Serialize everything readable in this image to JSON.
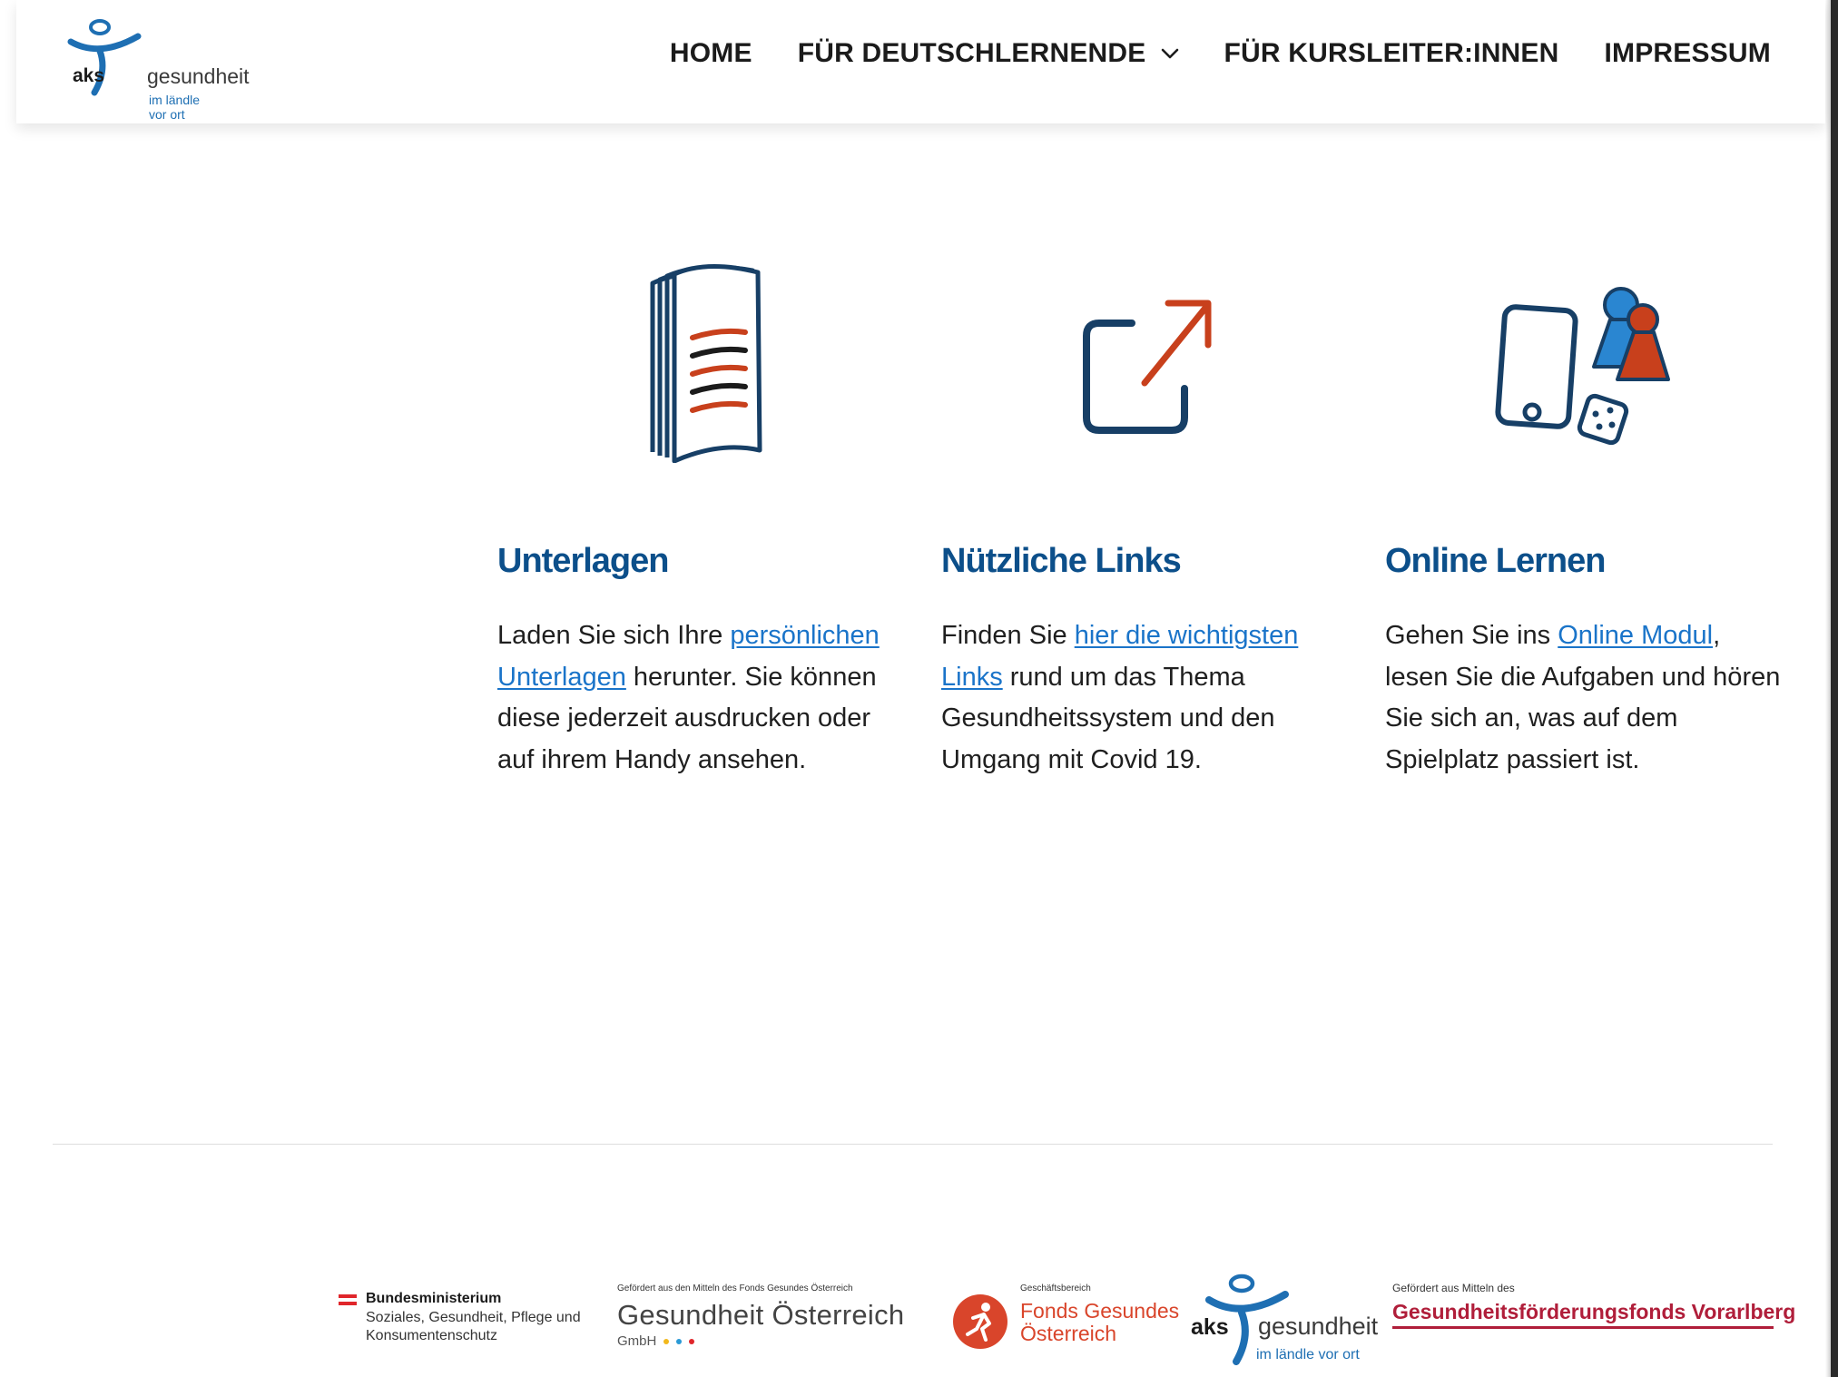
{
  "header": {
    "logo": {
      "brand": "aks",
      "name": "gesundheit",
      "tagline": "im ländle vor ort"
    },
    "nav": [
      {
        "label": "HOME"
      },
      {
        "label": "FÜR DEUTSCHLERNENDE",
        "has_dropdown": true
      },
      {
        "label": "FÜR KURSLEITER:INNEN"
      },
      {
        "label": "IMPRESSUM"
      }
    ]
  },
  "features": [
    {
      "icon": "documents-icon",
      "title": "Unterlagen",
      "text_before": "Laden Sie sich Ihre ",
      "link": "persönlichen Unterlagen",
      "text_after": " herunter. Sie können diese jederzeit ausdrucken oder auf ihrem Handy ansehen."
    },
    {
      "icon": "external-link-icon",
      "title": "Nützliche Links",
      "text_before": "Finden Sie ",
      "link": "hier die wichtigsten Links",
      "text_after": " rund um das Thema Gesundheitssystem und den Umgang mit Covid 19."
    },
    {
      "icon": "phone-game-icon",
      "title": "Online Lernen",
      "text_before": "Gehen Sie ins ",
      "link": "Online Modul",
      "text_after": ", lesen Sie die Aufgaben und hören Sie sich an, was auf dem Spielplatz passiert ist."
    }
  ],
  "footer": {
    "bmsgpk": {
      "title": "Bundesministerium",
      "sub": "Soziales, Gesundheit, Pflege und Konsumentenschutz"
    },
    "goe": {
      "small": "Gefördert aus den Mitteln des Fonds Gesundes Österreich",
      "name": "Gesundheit Österreich",
      "gmbh": "GmbH"
    },
    "fgoe": {
      "small": "Geschäftsbereich",
      "name_line1": "Fonds Gesundes",
      "name_line2": "Österreich"
    },
    "aks": {
      "brand": "aks",
      "name": "gesundheit",
      "tagline": "im ländle vor ort"
    },
    "gfv": {
      "small": "Gefördert aus Mitteln des",
      "name": "Gesundheitsförderungsfonds Vorarlberg"
    }
  },
  "colors": {
    "primary_blue": "#0c4f8a",
    "link_blue": "#1a74c9",
    "accent_red": "#c8401c",
    "icon_navy": "#173f66"
  }
}
